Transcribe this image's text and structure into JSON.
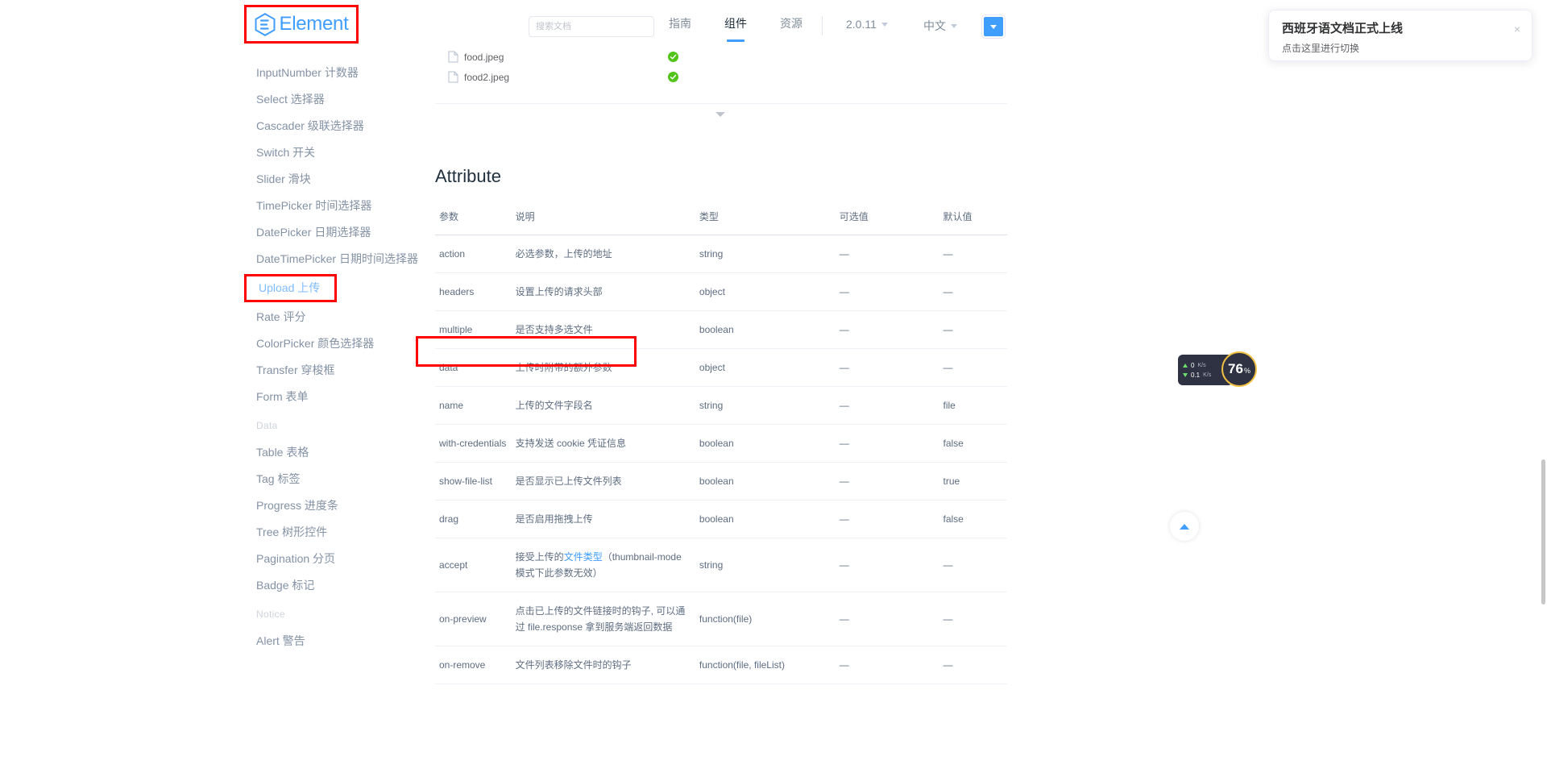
{
  "header": {
    "logo_text": "Element",
    "search_placeholder": "搜索文档",
    "search_value": "",
    "nav": [
      {
        "label": "指南",
        "active": false
      },
      {
        "label": "组件",
        "active": true
      },
      {
        "label": "资源",
        "active": false
      }
    ],
    "version": "2.0.11",
    "language": "中文",
    "theme_button": "chevron-down"
  },
  "notification": {
    "title": "西班牙语文档正式上线",
    "body": "点击这里进行切换",
    "close": "×"
  },
  "sidebar": {
    "items": [
      {
        "label": "InputNumber 计数器",
        "type": "item"
      },
      {
        "label": "Select 选择器",
        "type": "item"
      },
      {
        "label": "Cascader 级联选择器",
        "type": "item"
      },
      {
        "label": "Switch 开关",
        "type": "item"
      },
      {
        "label": "Slider 滑块",
        "type": "item"
      },
      {
        "label": "TimePicker 时间选择器",
        "type": "item"
      },
      {
        "label": "DatePicker 日期选择器",
        "type": "item"
      },
      {
        "label": "DateTimePicker 日期时间选择器",
        "type": "item"
      },
      {
        "label": "Upload 上传",
        "type": "item",
        "active": true,
        "highlighted": true
      },
      {
        "label": "Rate 评分",
        "type": "item"
      },
      {
        "label": "ColorPicker 颜色选择器",
        "type": "item"
      },
      {
        "label": "Transfer 穿梭框",
        "type": "item"
      },
      {
        "label": "Form 表单",
        "type": "item"
      },
      {
        "label": "Data",
        "type": "group"
      },
      {
        "label": "Table 表格",
        "type": "item"
      },
      {
        "label": "Tag 标签",
        "type": "item"
      },
      {
        "label": "Progress 进度条",
        "type": "item"
      },
      {
        "label": "Tree 树形控件",
        "type": "item"
      },
      {
        "label": "Pagination 分页",
        "type": "item"
      },
      {
        "label": "Badge 标记",
        "type": "item"
      },
      {
        "label": "Notice",
        "type": "group"
      },
      {
        "label": "Alert 警告",
        "type": "item"
      }
    ]
  },
  "upload_demo": {
    "files": [
      {
        "name": "food.jpeg",
        "status": "success"
      },
      {
        "name": "food2.jpeg",
        "status": "success"
      }
    ],
    "expand_icon": "chevron-down-icon"
  },
  "attribute_section": {
    "title": "Attribute",
    "columns": [
      "参数",
      "说明",
      "类型",
      "可选值",
      "默认值"
    ],
    "rows": [
      {
        "param": "action",
        "desc": "必选参数，上传的地址",
        "type": "string",
        "options": "—",
        "default": "—"
      },
      {
        "param": "headers",
        "desc": "设置上传的请求头部",
        "type": "object",
        "options": "—",
        "default": "—"
      },
      {
        "param": "multiple",
        "desc": "是否支持多选文件",
        "type": "boolean",
        "options": "—",
        "default": "—"
      },
      {
        "param": "data",
        "desc": "上传时附带的额外参数",
        "type": "object",
        "options": "—",
        "default": "—",
        "highlighted": true
      },
      {
        "param": "name",
        "desc": "上传的文件字段名",
        "type": "string",
        "options": "—",
        "default": "file"
      },
      {
        "param": "with-credentials",
        "desc": "支持发送 cookie 凭证信息",
        "type": "boolean",
        "options": "—",
        "default": "false"
      },
      {
        "param": "show-file-list",
        "desc": "是否显示已上传文件列表",
        "type": "boolean",
        "options": "—",
        "default": "true"
      },
      {
        "param": "drag",
        "desc": "是否启用拖拽上传",
        "type": "boolean",
        "options": "—",
        "default": "false"
      },
      {
        "param": "accept",
        "desc": "接受上传的文件类型（thumbnail-mode 模式下此参数无效）",
        "type": "string",
        "options": "—",
        "default": "—",
        "link_text": "文件类型"
      },
      {
        "param": "on-preview",
        "desc": "点击已上传的文件链接时的钩子, 可以通过 file.response 拿到服务端返回数据",
        "type": "function(file)",
        "options": "—",
        "default": "—"
      },
      {
        "param": "on-remove",
        "desc": "文件列表移除文件时的钩子",
        "type": "function(file, fileList)",
        "options": "—",
        "default": "—"
      }
    ]
  },
  "widgets": {
    "net_up_value": "0",
    "net_up_unit": "K/s",
    "net_down_value": "0.1",
    "net_down_unit": "K/s",
    "cpu_value": "76",
    "cpu_unit": "%",
    "back_to_top": "back-to-top-icon"
  },
  "colors": {
    "accent": "#409eff",
    "highlight": "#ff0000",
    "success": "#67c23a",
    "text_primary": "#1f2f3d",
    "text_regular": "#5e6d82",
    "text_secondary": "#8492a6"
  }
}
